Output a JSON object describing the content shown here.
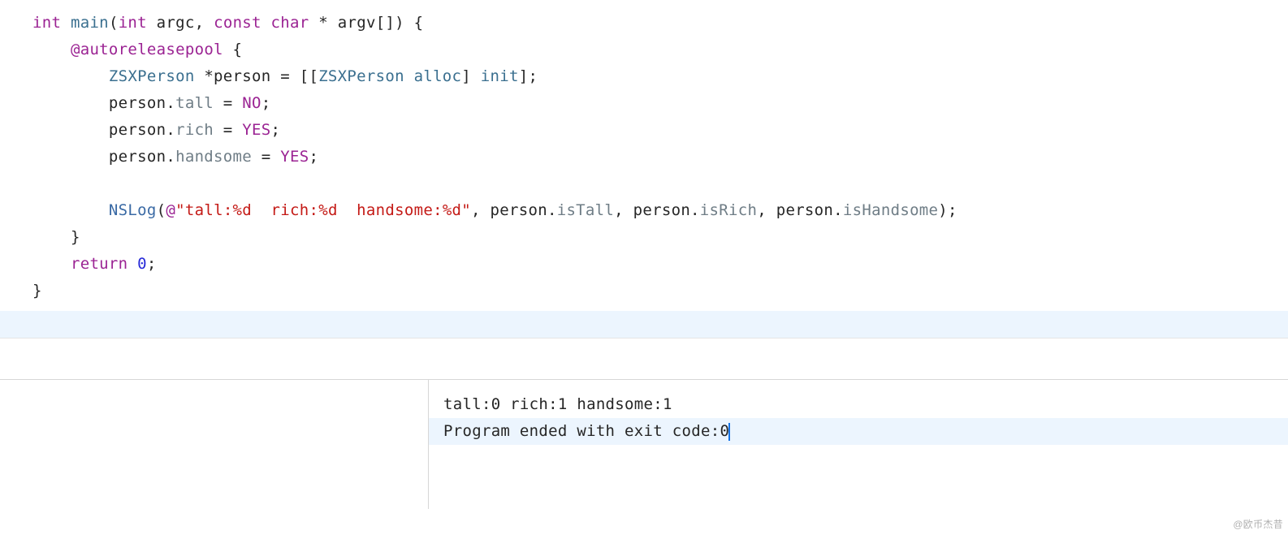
{
  "code": {
    "l1_int": "int",
    "l1_main": "main",
    "l1_paren_open": "(",
    "l1_int2": "int",
    "l1_argc": " argc, ",
    "l1_const": "const",
    "l1_space": " ",
    "l1_char": "char",
    "l1_argv": " * argv[]) {",
    "l2_indent": "    ",
    "l2_auto": "@autoreleasepool",
    "l2_brace": " {",
    "l3_indent": "        ",
    "l3_zsx": "ZSXPerson",
    "l3_mid": " *person = [[",
    "l3_zsx2": "ZSXPerson",
    "l3_space": " ",
    "l3_alloc": "alloc",
    "l3_mid2": "] ",
    "l3_init": "init",
    "l3_end": "];",
    "l4_indent": "        person.",
    "l4_prop": "tall",
    "l4_eq": " = ",
    "l4_val": "NO",
    "l4_semi": ";",
    "l5_indent": "        person.",
    "l5_prop": "rich",
    "l5_eq": " = ",
    "l5_val": "YES",
    "l5_semi": ";",
    "l6_indent": "        person.",
    "l6_prop": "handsome",
    "l6_eq": " = ",
    "l6_val": "YES",
    "l6_semi": ";",
    "l7_blank": "",
    "l8_indent": "        ",
    "l8_nslog": "NSLog",
    "l8_paren": "(",
    "l8_at": "@",
    "l8_str": "\"tall:%d  rich:%d  handsome:%d\"",
    "l8_mid1": ", person.",
    "l8_p1": "isTall",
    "l8_mid2": ", person.",
    "l8_p2": "isRich",
    "l8_mid3": ", person.",
    "l8_p3": "isHandsome",
    "l8_end": ");",
    "l9_indent": "    }",
    "l10_indent": "    ",
    "l10_return": "return",
    "l10_space": " ",
    "l10_zero": "0",
    "l10_semi": ";",
    "l11_close": "}"
  },
  "console": {
    "line1": "tall:0  rich:1  handsome:1",
    "line2_prefix": "Program ended with exit code: ",
    "line2_code": "0"
  },
  "watermark": "@欧币杰昔"
}
